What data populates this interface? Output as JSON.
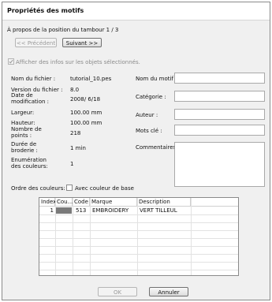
{
  "window": {
    "title": "Propriétés des motifs"
  },
  "nav": {
    "position_text": "À propos de la position du tambour 1 / 3",
    "prev_label": "<< Précédent",
    "next_label": "Suivant >>"
  },
  "show_info": {
    "label": "Afficher des infos sur les objets sélectionnés.",
    "checked": true,
    "enabled": false
  },
  "info": {
    "filename_label": "Nom du fichier :",
    "filename_value": "tutorial_10.pes",
    "version_label": "Version du fichier :",
    "version_value": "8.0",
    "date_label_1": "Date de",
    "date_label_2": "modification :",
    "date_value": "2008/ 6/18",
    "width_label": "Largeur:",
    "width_value": "100.00 mm",
    "height_label": "Hauteur:",
    "height_value": "100.00 mm",
    "points_label_1": "Nombre de",
    "points_label_2": "points :",
    "points_value": "218",
    "duration_label_1": "Durée de",
    "duration_label_2": "broderie :",
    "duration_value": "1 min",
    "colors_label_1": "Enumération",
    "colors_label_2": "des couleurs:",
    "colors_value": "1"
  },
  "meta": {
    "pattern_name_label": "Nom du motif :",
    "pattern_name_value": "",
    "category_label": "Catégorie :",
    "category_value": "",
    "author_label": "Auteur :",
    "author_value": "",
    "keywords_label": "Mots clé :",
    "keywords_value": "",
    "comments_label": "Commentaires :",
    "comments_value": ""
  },
  "color_order": {
    "label": "Ordre des couleurs:",
    "base_color_label": "Avec couleur de base",
    "base_color_checked": false
  },
  "table": {
    "headers": [
      "Index",
      "Cou...",
      "Code",
      "Marque",
      "Description"
    ],
    "rows": [
      {
        "index": "1",
        "color": "#7a7a7a",
        "code": "513",
        "brand": "EMBROIDERY",
        "description": "VERT TILLEUL"
      }
    ]
  },
  "footer": {
    "ok_label": "OK",
    "cancel_label": "Annuler"
  }
}
